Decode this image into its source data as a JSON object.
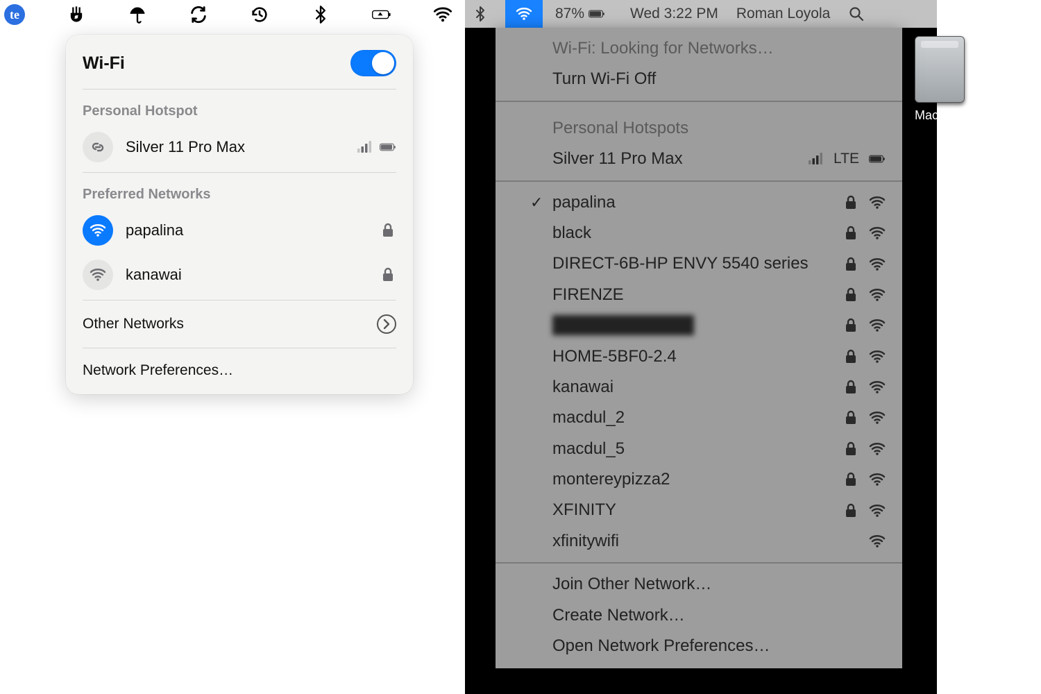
{
  "left": {
    "popover": {
      "title": "Wi-Fi",
      "toggle_on": true,
      "hotspot_section": "Personal Hotspot",
      "hotspot": {
        "name": "Silver 11 Pro Max"
      },
      "preferred_section": "Preferred Networks",
      "preferred": [
        {
          "name": "papalina",
          "connected": true,
          "locked": true
        },
        {
          "name": "kanawai",
          "connected": false,
          "locked": true
        }
      ],
      "other_networks": "Other Networks",
      "prefs": "Network Preferences…"
    }
  },
  "right": {
    "menubar": {
      "battery_pct": "87%",
      "clock": "Wed 3:22 PM",
      "user": "Roman Loyola"
    },
    "menu": {
      "status": "Wi-Fi: Looking for Networks…",
      "turn_off": "Turn Wi-Fi Off",
      "hotspots_section": "Personal Hotspots",
      "hotspot": {
        "name": "Silver 11 Pro Max",
        "signal_label": "LTE"
      },
      "networks": [
        {
          "name": "papalina",
          "connected": true,
          "locked": true
        },
        {
          "name": "black",
          "locked": true
        },
        {
          "name": "DIRECT-6B-HP ENVY 5540 series",
          "locked": true
        },
        {
          "name": "FIRENZE",
          "locked": true
        },
        {
          "name": "████████████",
          "blurred": true,
          "locked": true
        },
        {
          "name": "HOME-5BF0-2.4",
          "locked": true
        },
        {
          "name": "kanawai",
          "locked": true
        },
        {
          "name": "macdul_2",
          "locked": true
        },
        {
          "name": "macdul_5",
          "locked": true
        },
        {
          "name": "montereypizza2",
          "locked": true
        },
        {
          "name": "XFINITY",
          "locked": true
        },
        {
          "name": "xfinitywifi",
          "locked": false
        }
      ],
      "join_other": "Join Other Network…",
      "create": "Create Network…",
      "open_prefs": "Open Network Preferences…"
    },
    "drive_label": "Macintosh HD"
  }
}
